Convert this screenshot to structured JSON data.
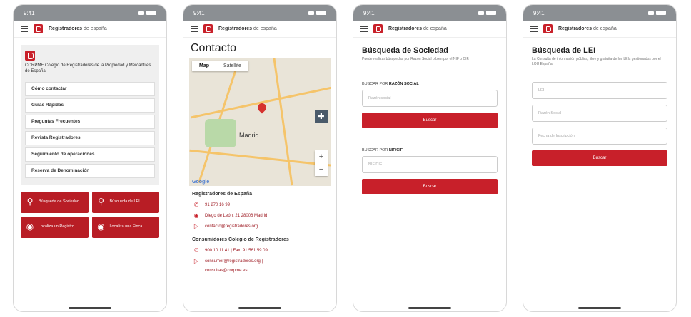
{
  "app": {
    "brand_name": "Registradores",
    "brand_suffix": "de españa"
  },
  "screens": [
    {
      "time": "9:41",
      "org_name": "CORPME Colegio de Registradores de la Propiedad y Mercantiles de España",
      "menu": [
        "Cómo contactar",
        "Guías Rápidas",
        "Preguntas Frecuentes",
        "Revista Registradores",
        "Seguimiento de operaciones",
        "Reserva de Denominación"
      ],
      "tiles": [
        {
          "icon": "search-icon",
          "label": "Búsqueda de Sociedad"
        },
        {
          "icon": "search-icon",
          "label": "Búsqueda de LEI"
        },
        {
          "icon": "location-icon",
          "label": "Localiza un Registro"
        },
        {
          "icon": "location-icon",
          "label": "Localiza una Finca"
        }
      ]
    },
    {
      "time": "9:41",
      "title": "Contacto",
      "map_tabs": [
        "Map",
        "Satellite"
      ],
      "map_city": "Madrid",
      "google": "Google",
      "section1_title": "Registradores de España",
      "section1_rows": [
        {
          "icon": "phone-icon",
          "text": "91 270 16 99"
        },
        {
          "icon": "location-icon",
          "text": "Diego de León, 21 28006 Madrid"
        },
        {
          "icon": "send-icon",
          "text": "contacto@registradores.org"
        }
      ],
      "section2_title": "Consumidores Colegio de Registradores",
      "section2_rows": [
        {
          "icon": "phone-icon",
          "text": "900 10 11 41  |  Fax: 91 561 59 09"
        },
        {
          "icon": "send-icon",
          "text": "consumer@registradores.org  |"
        },
        {
          "icon": "",
          "text": "consultas@corpme.es"
        }
      ]
    },
    {
      "time": "9:41",
      "title": "Búsqueda de Sociedad",
      "subtitle": "Puede realizar búsquedas por Razón Social o bien por el NIF o CIF.",
      "label1_prefix": "BUSCAR POR",
      "label1_bold": "RAZÓN SOCIAL",
      "placeholder1": "Razón social",
      "button1": "Buscar",
      "label2_prefix": "BUSCAR POR",
      "label2_bold": "NIF/CIF",
      "placeholder2": "NIF/CIF",
      "button2": "Buscar"
    },
    {
      "time": "9:41",
      "title": "Búsqueda de LEI",
      "subtitle": "La Consulta de información pública, libre y gratuita de los LEIs gestionados por el LOU España.",
      "fields": [
        "LEI",
        "Razón Social",
        "Fecha de Inscripción"
      ],
      "button": "Buscar"
    }
  ],
  "colors": {
    "brand_red": "#c8202a",
    "tile_red": "#b81d25"
  }
}
